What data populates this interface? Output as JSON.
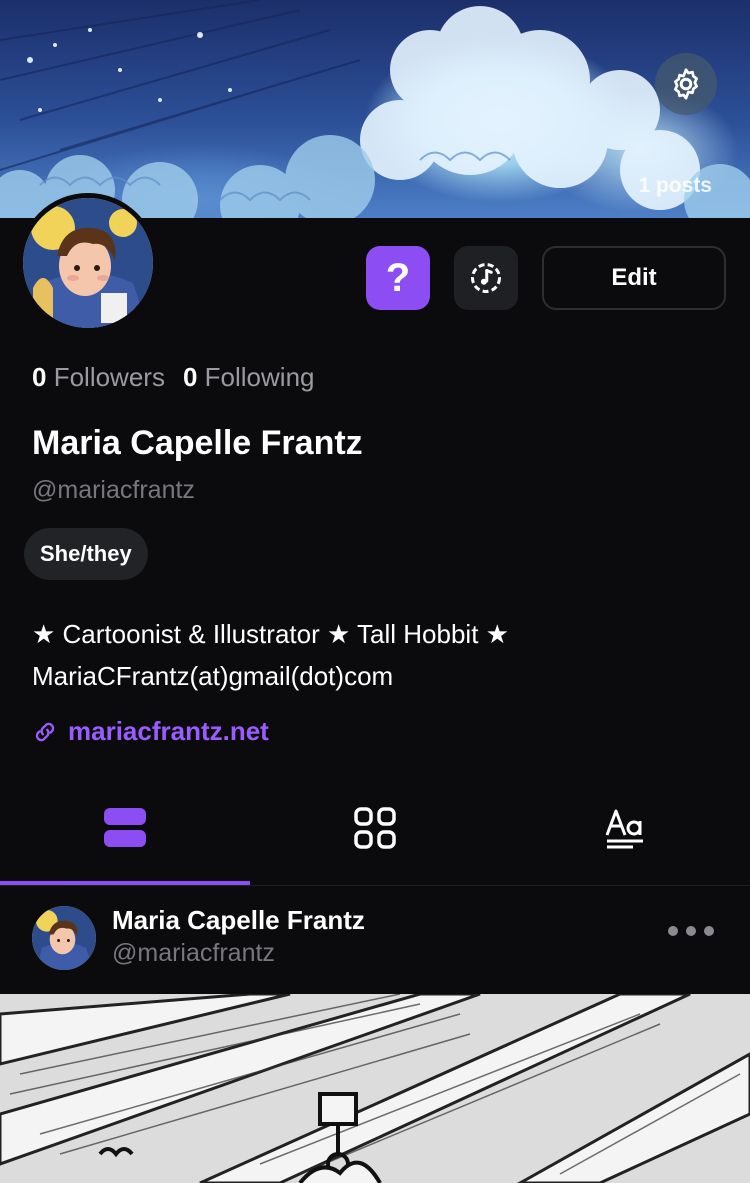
{
  "banner": {
    "posts_count": "1 posts"
  },
  "profile": {
    "followers_count": "0",
    "followers_label": "Followers",
    "following_count": "0",
    "following_label": "Following",
    "name": "Maria Capelle Frantz",
    "handle": "@mariacfrantz",
    "pronouns": "She/they",
    "bio_line1": "★ Cartoonist & Illustrator ★ Tall Hobbit ★",
    "bio_line2": "MariaCFrantz(at)gmail(dot)com",
    "link": "mariacfrantz.net"
  },
  "actions": {
    "ask_label": "?",
    "edit_label": "Edit"
  },
  "tabs": [
    {
      "icon": "posts-list-icon",
      "active": true
    },
    {
      "icon": "grid-icon",
      "active": false
    },
    {
      "icon": "text-posts-icon",
      "active": false
    }
  ],
  "post": {
    "author_name": "Maria Capelle Frantz",
    "author_handle": "@mariacfrantz"
  },
  "colors": {
    "accent": "#8c4df3",
    "link": "#9b5cff",
    "background": "#0b0b0d"
  }
}
